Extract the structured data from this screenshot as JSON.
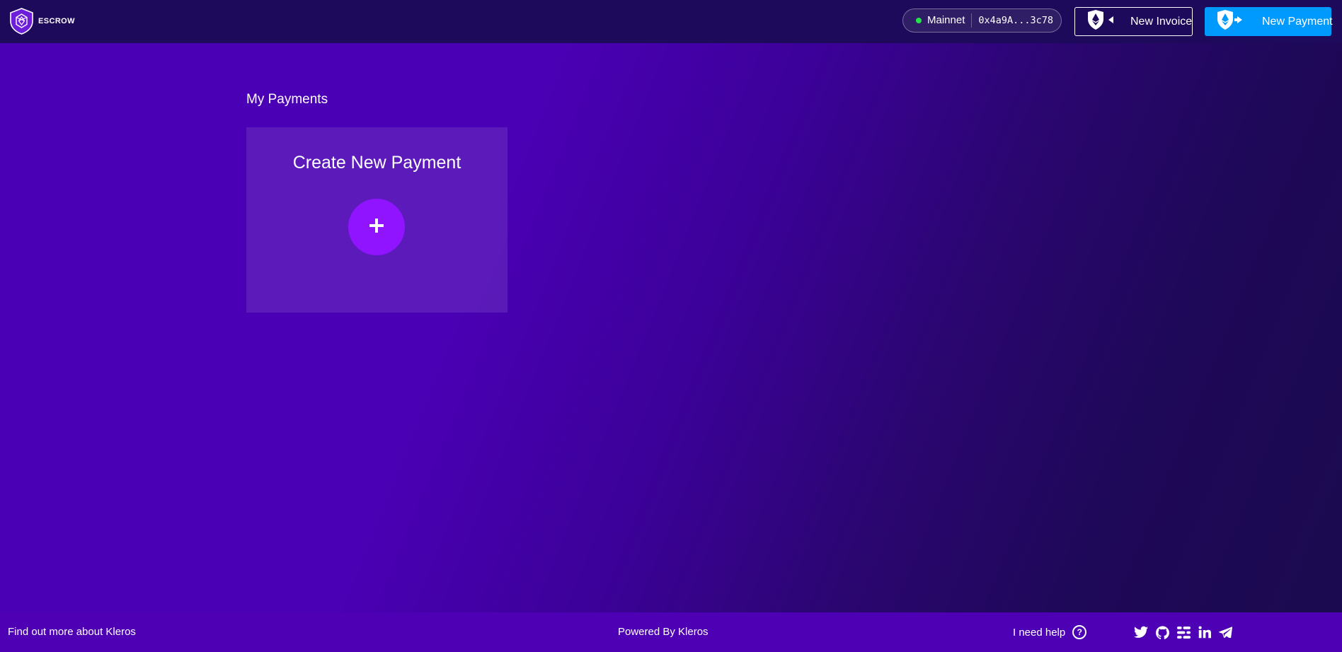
{
  "header": {
    "brand": {
      "logo_icon": "kleros-shield-logo-icon",
      "name": "ESCROW"
    },
    "network": {
      "status_color": "#22e34a",
      "name": "Mainnet",
      "address": "0x4a9A...3c78"
    },
    "new_invoice": {
      "label": "New Invoice",
      "icon": "ethereum-arrow-in-icon"
    },
    "new_payment": {
      "label": "New Payment",
      "icon": "ethereum-arrow-out-icon",
      "color": "#009aff"
    }
  },
  "main": {
    "section_title": "My Payments",
    "create_card": {
      "title": "Create New Payment",
      "action_icon": "plus-icon",
      "action_color": "#9014ff"
    }
  },
  "footer": {
    "left_link": "Find out more about Kleros",
    "center_text": "Powered By Kleros",
    "help_text": "I need help",
    "help_icon": "question-circle-icon",
    "social_icons": [
      "twitter-icon",
      "github-icon",
      "slack-icon",
      "linkedin-icon",
      "telegram-icon"
    ]
  },
  "colors": {
    "header_bg": "#1e0a5a",
    "page_gradient_start": "#4a00b4",
    "page_gradient_end": "#1b0a4f",
    "footer_bg": "#4d00b4"
  }
}
